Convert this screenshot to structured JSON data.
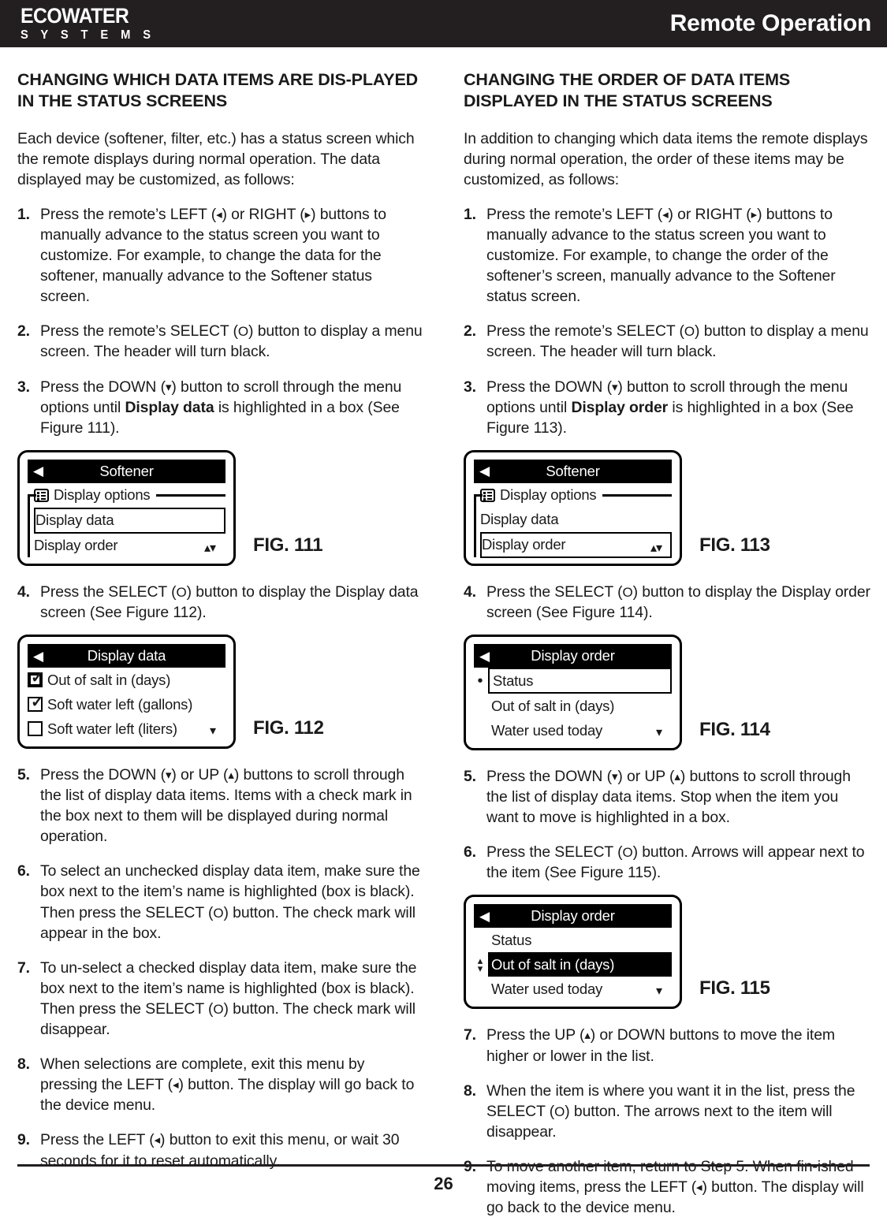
{
  "header": {
    "logo_main": "ECOWATER",
    "logo_sub": "S Y S T E M S",
    "title": "Remote Operation"
  },
  "glyphs": {
    "left": "◂",
    "right": "▸",
    "down": "▾",
    "up": "▴",
    "select": "O",
    "back_caret": "◀",
    "scroll_updown": "▴▾",
    "scroll_down": "▾",
    "check": "✓",
    "bullet": "•",
    "move_up": "▴",
    "move_down": "▾"
  },
  "left_column": {
    "title": "CHANGING WHICH DATA ITEMS ARE DIS-PLAYED IN THE STATUS SCREENS",
    "intro": "Each device (softener, filter, etc.) has a status screen which the remote displays during normal operation. The data displayed may be customized, as follows:",
    "steps": [
      {
        "num": "1.",
        "segments": [
          {
            "t": "Press the remote’s LEFT ("
          },
          {
            "g": "left"
          },
          {
            "t": ") or RIGHT ("
          },
          {
            "g": "right"
          },
          {
            "t": ") buttons to manually advance to the status screen you want to customize.  For example, to change the data for the softener, manually advance to the Softener status screen."
          }
        ]
      },
      {
        "num": "2.",
        "segments": [
          {
            "t": "Press the remote’s SELECT ("
          },
          {
            "s": "O"
          },
          {
            "t": ") button to display a menu screen.  The header will turn black."
          }
        ]
      },
      {
        "num": "3.",
        "segments": [
          {
            "t": "Press the DOWN ("
          },
          {
            "g": "down"
          },
          {
            "t": ") button to scroll through the menu options until "
          },
          {
            "b": "Display data"
          },
          {
            "t": " is highlighted in a box (See Figure 111)."
          }
        ]
      },
      {
        "num": "4.",
        "segments": [
          {
            "t": "Press the SELECT ("
          },
          {
            "s": "O"
          },
          {
            "t": ") button to display the Display data screen (See Figure 112)."
          }
        ]
      },
      {
        "num": "5.",
        "segments": [
          {
            "t": "Press the DOWN ("
          },
          {
            "g": "down"
          },
          {
            "t": ") or UP ("
          },
          {
            "g": "up"
          },
          {
            "t": ") buttons to scroll through the list of display data items.  Items with a check mark in the box next to them will be displayed during normal operation."
          }
        ]
      },
      {
        "num": "6.",
        "segments": [
          {
            "t": "To select an unchecked display data item, make sure the box next to the item’s name is highlighted (box is black).  Then press the SELECT ("
          },
          {
            "s": "O"
          },
          {
            "t": ") button. The check mark will appear in the box."
          }
        ]
      },
      {
        "num": "7.",
        "segments": [
          {
            "t": "To un-select a checked display data item, make sure the box next to the item’s name is highlighted (box is black).  Then press the SELECT ("
          },
          {
            "s": "O"
          },
          {
            "t": ") button. The check mark will disappear."
          }
        ]
      },
      {
        "num": "8.",
        "segments": [
          {
            "t": "When selections are complete, exit this menu by pressing the LEFT ("
          },
          {
            "g": "left"
          },
          {
            "t": ") button.  The display will go back to the device menu."
          }
        ]
      },
      {
        "num": "9.",
        "segments": [
          {
            "t": "Press the LEFT ("
          },
          {
            "g": "left"
          },
          {
            "t": ") button to exit this menu, or wait 30 seconds for it to reset automatically."
          }
        ]
      }
    ]
  },
  "right_column": {
    "title": "CHANGING THE ORDER OF DATA ITEMS DISPLAYED IN THE STATUS SCREENS",
    "intro": "In addition to changing which data items the remote displays during normal operation, the order of these items may be customized, as follows:",
    "steps": [
      {
        "num": "1.",
        "segments": [
          {
            "t": "Press the remote’s LEFT ("
          },
          {
            "g": "left"
          },
          {
            "t": ") or RIGHT ("
          },
          {
            "g": "right"
          },
          {
            "t": ") buttons to manually advance to the status screen you want to customize.  For example, to change the order of the softener’s screen, manually advance to the Softener status screen."
          }
        ]
      },
      {
        "num": "2.",
        "segments": [
          {
            "t": "Press the remote’s SELECT ("
          },
          {
            "s": "O"
          },
          {
            "t": ") button to display a menu screen.  The header will turn black."
          }
        ]
      },
      {
        "num": "3.",
        "segments": [
          {
            "t": "Press the DOWN ("
          },
          {
            "g": "down"
          },
          {
            "t": ") button to scroll through the menu options until "
          },
          {
            "b": "Display order"
          },
          {
            "t": " is highlighted in a box (See Figure 113)."
          }
        ]
      },
      {
        "num": "4.",
        "segments": [
          {
            "t": "Press the SELECT ("
          },
          {
            "s": "O"
          },
          {
            "t": ") button to display the Display order screen (See Figure 114)."
          }
        ]
      },
      {
        "num": "5.",
        "segments": [
          {
            "t": "Press the DOWN ("
          },
          {
            "g": "down"
          },
          {
            "t": ") or UP ("
          },
          {
            "g": "up"
          },
          {
            "t": ") buttons to scroll through the list of display data items.  Stop when the item you want to move is highlighted in a box."
          }
        ]
      },
      {
        "num": "6.",
        "segments": [
          {
            "t": "Press the SELECT ("
          },
          {
            "s": "O"
          },
          {
            "t": ") button.  Arrows will appear next to the item (See Figure 115)."
          }
        ]
      },
      {
        "num": "7.",
        "segments": [
          {
            "t": "Press the UP ("
          },
          {
            "g": "up"
          },
          {
            "t": ") or DOWN buttons to move the item higher or lower in the list."
          }
        ]
      },
      {
        "num": "8.",
        "segments": [
          {
            "t": "When the item is where you want it in the list, press the SELECT ("
          },
          {
            "s": "O"
          },
          {
            "t": ") button.  The arrows next to the item will disappear."
          }
        ]
      },
      {
        "num": "9.",
        "segments": [
          {
            "t": "To move another item, return to Step 5.  When fin-ished moving items, press the LEFT ("
          },
          {
            "g": "left"
          },
          {
            "t": ") button.  The display will go back to the device menu."
          }
        ]
      }
    ]
  },
  "figures": {
    "fig111": {
      "label": "FIG. 111",
      "screen_title": "Softener",
      "group_label": "Display options",
      "rows": [
        {
          "text": "Display data",
          "style": "boxed"
        },
        {
          "text": "Display order",
          "style": "plain"
        }
      ],
      "scroll": "updown"
    },
    "fig112": {
      "label": "FIG. 112",
      "screen_title": "Display data",
      "rows": [
        {
          "text": "Out of salt in (days)",
          "checked": true,
          "highlighted": true
        },
        {
          "text": "Soft water left (gallons)",
          "checked": true,
          "highlighted": false
        },
        {
          "text": "Soft water left (liters)",
          "checked": false,
          "highlighted": false
        }
      ],
      "scroll": "down"
    },
    "fig113": {
      "label": "FIG. 113",
      "screen_title": "Softener",
      "group_label": "Display options",
      "rows": [
        {
          "text": "Display data",
          "style": "plain"
        },
        {
          "text": "Display order",
          "style": "boxed"
        }
      ],
      "scroll": "updown"
    },
    "fig114": {
      "label": "FIG. 114",
      "screen_title": "Display order",
      "rows": [
        {
          "text": "Status",
          "marker": "bullet",
          "style": "boxed"
        },
        {
          "text": "Out of salt in (days)",
          "marker": "none",
          "style": "plain"
        },
        {
          "text": "Water used today",
          "marker": "none",
          "style": "plain"
        }
      ],
      "scroll": "down"
    },
    "fig115": {
      "label": "FIG. 115",
      "screen_title": "Display order",
      "rows": [
        {
          "text": "Status",
          "marker": "none",
          "style": "plain"
        },
        {
          "text": "Out of salt in (days)",
          "marker": "updown",
          "style": "inverted"
        },
        {
          "text": "Water used today",
          "marker": "none",
          "style": "plain"
        }
      ],
      "scroll": "down"
    }
  },
  "footer": {
    "page_number": "26"
  }
}
